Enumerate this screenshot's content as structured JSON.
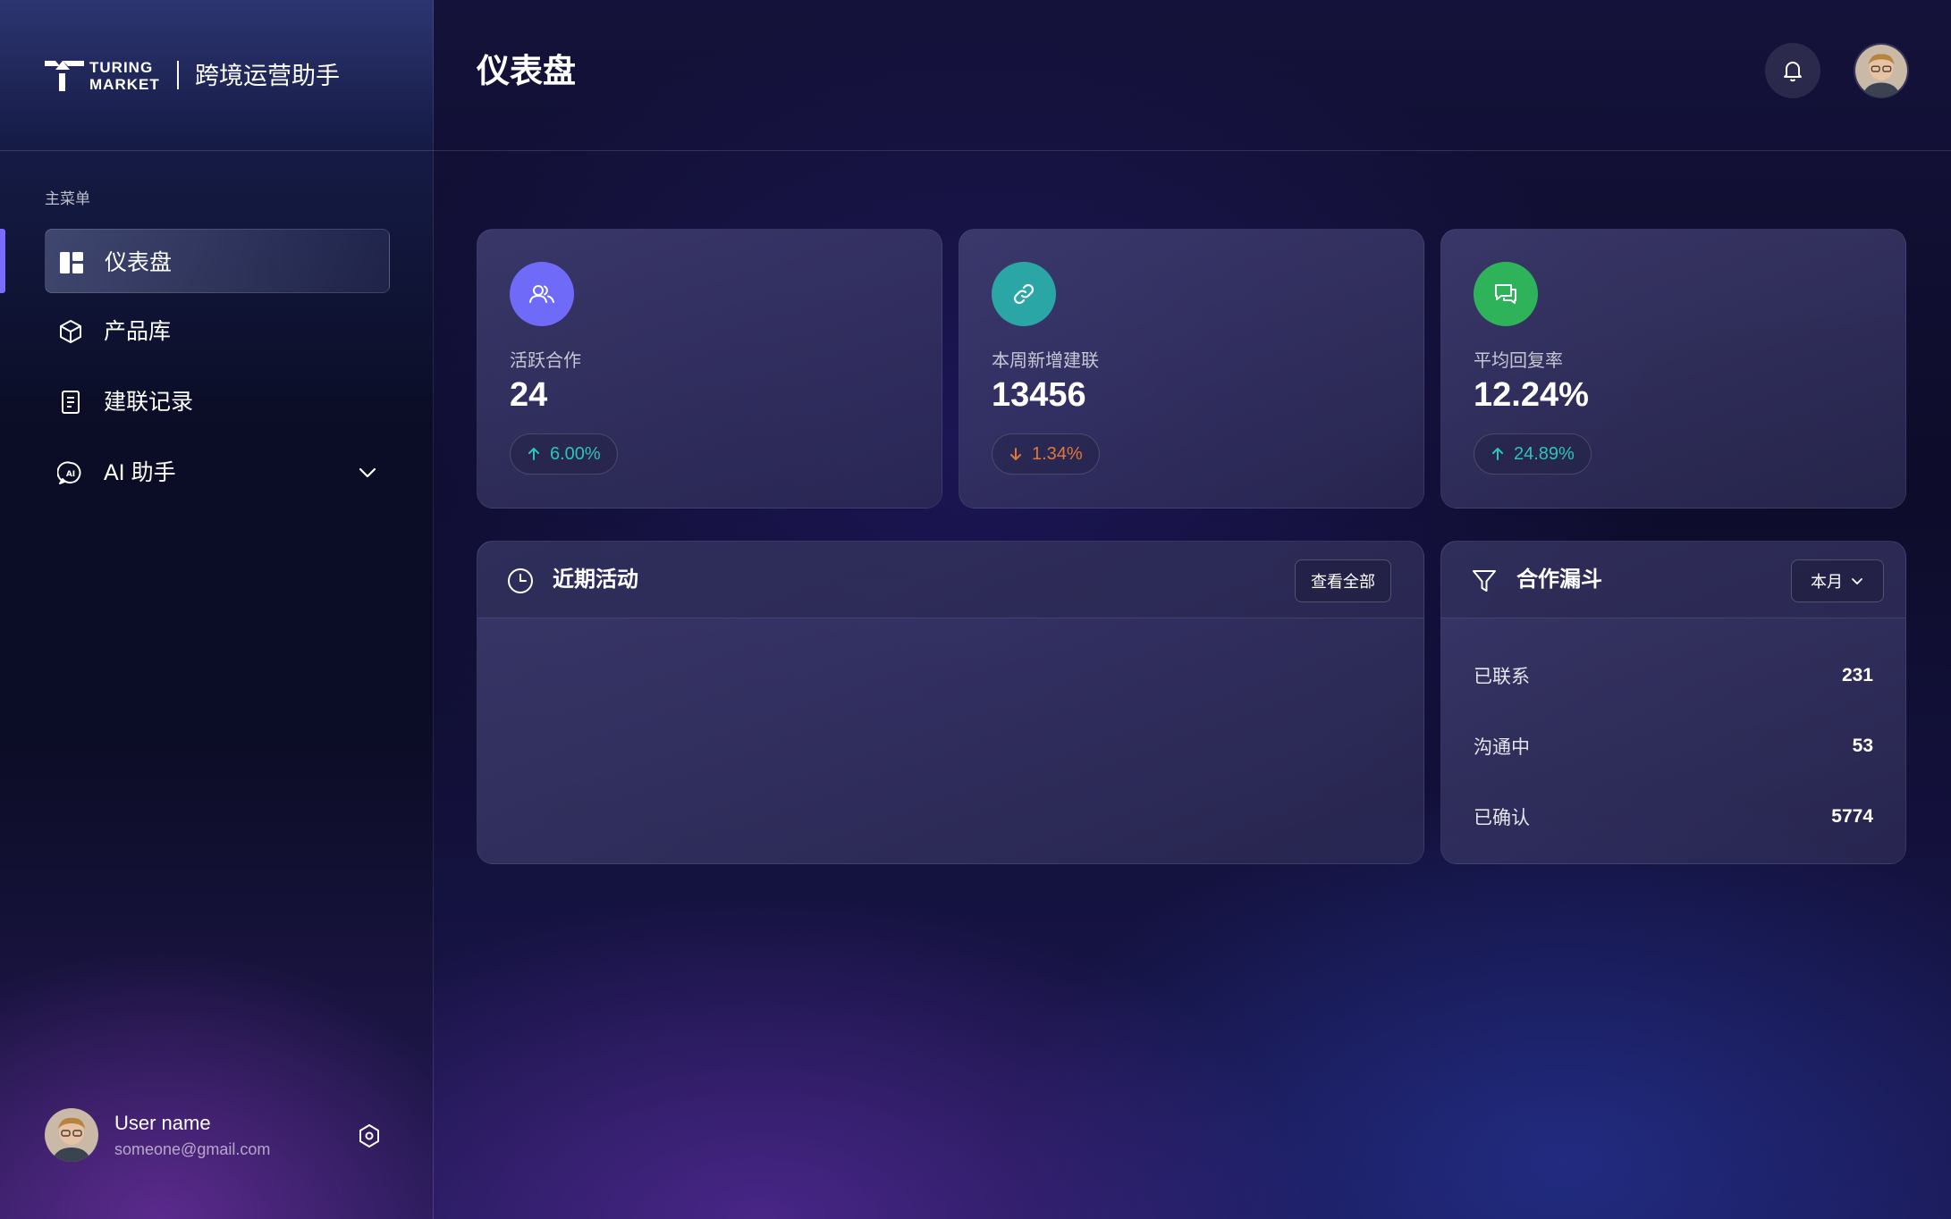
{
  "brand": {
    "wordmark_line1": "TURING",
    "wordmark_line2": "MARKET",
    "app_name": "跨境运营助手"
  },
  "sidebar": {
    "section_label": "主菜单",
    "items": [
      {
        "label": "仪表盘",
        "icon": "dashboard-icon",
        "active": true
      },
      {
        "label": "产品库",
        "icon": "cube-icon",
        "active": false
      },
      {
        "label": "建联记录",
        "icon": "document-icon",
        "active": false
      },
      {
        "label": "AI 助手",
        "icon": "ai-chat-icon",
        "active": false,
        "expandable": true
      }
    ],
    "user": {
      "name": "User name",
      "email": "someone@gmail.com"
    }
  },
  "header": {
    "title": "仪表盘"
  },
  "stats": [
    {
      "label": "活跃合作",
      "value": "24",
      "trend": "6.00%",
      "direction": "up",
      "icon": "users-icon",
      "icon_color": "#6f6af8"
    },
    {
      "label": "本周新增建联",
      "value": "13456",
      "trend": "1.34%",
      "direction": "down",
      "icon": "link-icon",
      "icon_color": "#2aa6a6"
    },
    {
      "label": "平均回复率",
      "value": "12.24%",
      "trend": "24.89%",
      "direction": "up",
      "icon": "chat-icon",
      "icon_color": "#2fb35a"
    }
  ],
  "activity": {
    "title": "近期活动",
    "view_all": "查看全部"
  },
  "funnel": {
    "title": "合作漏斗",
    "period": "本月",
    "rows": [
      {
        "name": "已联系",
        "value": "231"
      },
      {
        "name": "沟通中",
        "value": "53"
      },
      {
        "name": "已确认",
        "value": "5774"
      }
    ]
  },
  "colors": {
    "accent": "#7b6cff",
    "trend_up": "#2ec4b6",
    "trend_down": "#e0773a"
  }
}
